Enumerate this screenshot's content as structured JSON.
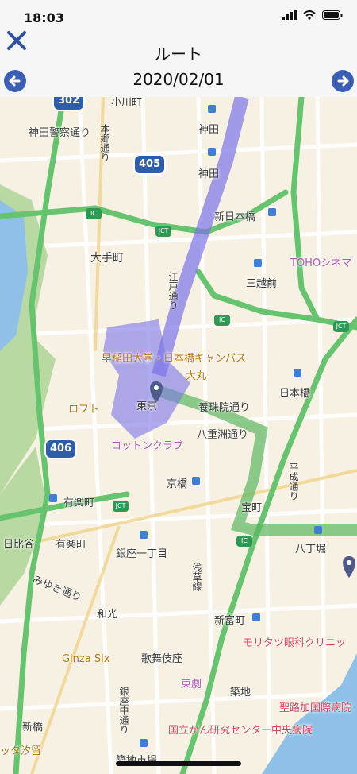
{
  "status": {
    "time": "18:03"
  },
  "header": {
    "title": "ルート",
    "date": "2020/02/01"
  },
  "map": {
    "road_numbers": [
      "302",
      "405",
      "406"
    ],
    "labels": [
      "小川町",
      "神田警察通り",
      "本郷通り",
      "神田",
      "神田",
      "新日本橋",
      "大手町",
      "三越前",
      "江戸通り",
      "早稲田大学・日本橋キャンパス",
      "大丸",
      "東京",
      "日本橋",
      "ロフト",
      "養珠院通り",
      "八重洲通り",
      "コットンクラブ",
      "京橋",
      "宝町",
      "平成通り",
      "有楽町",
      "日比谷",
      "有楽町",
      "銀座一丁目",
      "八丁堀",
      "みゆき通り",
      "和光",
      "新富町",
      "モリタツ眼科クリニッ",
      "Ginza Six",
      "歌舞伎座",
      "東劇",
      "築地",
      "聖路加国際病院",
      "国立がん研究センター中央病院",
      "新橋",
      "ッタ汐留",
      "築地市場",
      "TOHOシネマ",
      "浅草線",
      "銀座中通り"
    ],
    "ic_label": "IC",
    "jct_label": "JCT",
    "colors": {
      "route": "#7b74e8",
      "road": "#5dc26a",
      "green": "#6fbf73",
      "water": "#7fb5e6"
    }
  }
}
